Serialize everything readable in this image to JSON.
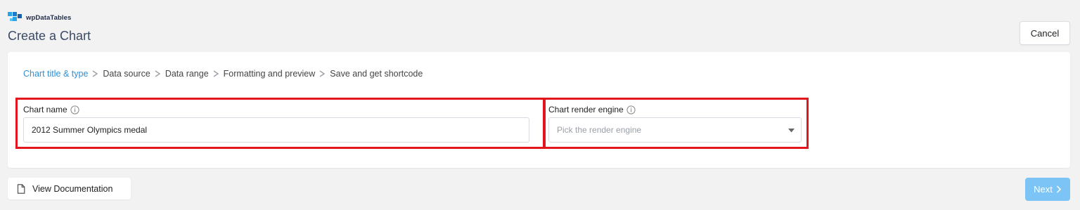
{
  "brand": {
    "name": "wpDataTables"
  },
  "header": {
    "title": "Create a Chart",
    "cancel_label": "Cancel"
  },
  "steps": [
    {
      "label": "Chart title & type",
      "active": true
    },
    {
      "label": "Data source",
      "active": false
    },
    {
      "label": "Data range",
      "active": false
    },
    {
      "label": "Formatting and preview",
      "active": false
    },
    {
      "label": "Save and get shortcode",
      "active": false
    }
  ],
  "fields": {
    "chart_name": {
      "label": "Chart name",
      "value": "2012 Summer Olympics medal"
    },
    "render_engine": {
      "label": "Chart render engine",
      "placeholder": "Pick the render engine"
    }
  },
  "footer": {
    "doc_label": "View Documentation",
    "next_label": "Next"
  },
  "colors": {
    "accent": "#2f8fd6",
    "highlight": "#e3161d",
    "next_button": "#7cc4f5"
  },
  "icons": [
    "wpdatatables-logo-icon",
    "chevron-right-icon",
    "info-icon",
    "caret-down-icon",
    "document-icon"
  ]
}
